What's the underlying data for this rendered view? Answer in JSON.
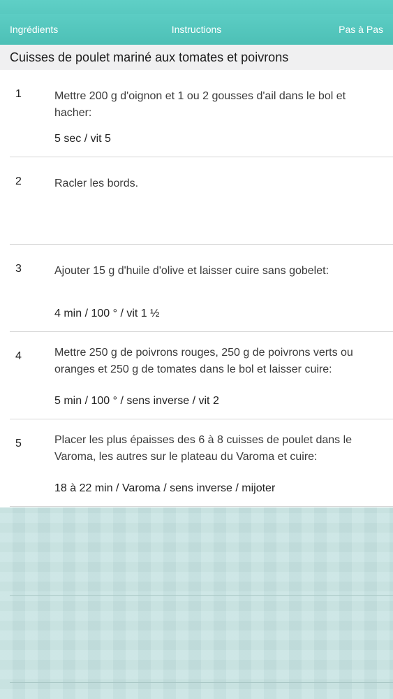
{
  "nav": {
    "left_label": "Ingrédients",
    "title": "Instructions",
    "right_label": "Pas à Pas"
  },
  "recipe": {
    "title": "Cuisses de poulet mariné aux tomates et poivrons"
  },
  "steps": [
    {
      "number": "1",
      "text": "Mettre 200 g d'oignon et 1 ou 2 gousses d'ail dans le bol et hacher:",
      "setting": "5 sec / vit 5"
    },
    {
      "number": "2",
      "text": "Racler les bords.",
      "setting": ""
    },
    {
      "number": "3",
      "text": "Ajouter 15 g d'huile d'olive et laisser cuire sans gobelet:",
      "setting": "4 min / 100 ° / vit 1 ½"
    },
    {
      "number": "4",
      "text": "Mettre 250 g de poivrons rouges, 250 g de poivrons verts ou oranges et 250 g de tomates dans le bol et laisser cuire:",
      "setting": "5 min / 100 ° /  sens inverse / vit 2"
    },
    {
      "number": "5",
      "text": "Placer les plus épaisses des 6 à 8 cuisses de poulet dans le Varoma, les autres sur le plateau du Varoma et cuire:",
      "setting": "18 à 22 min / Varoma /  sens inverse /  mijoter"
    }
  ],
  "colors": {
    "nav_background": "#52c5bb",
    "section_header_background": "#f0f0f1",
    "blank_area_background": "#c7e3e2"
  }
}
